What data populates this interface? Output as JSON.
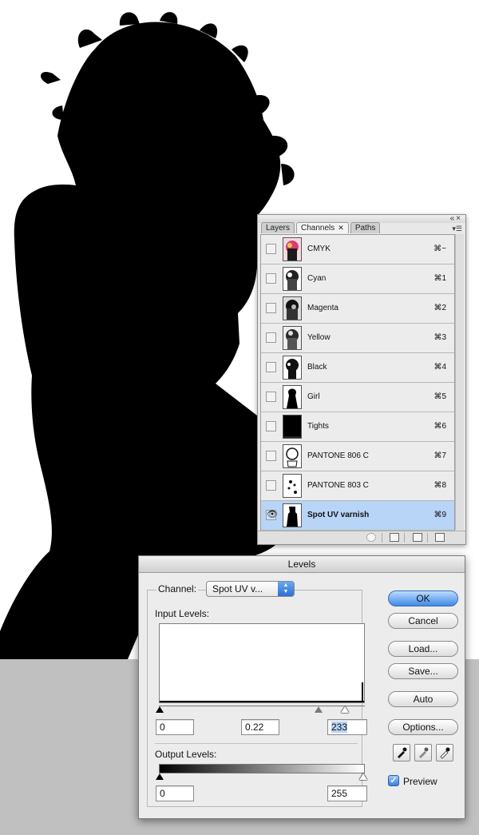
{
  "colors": {
    "canvas_bg": "#ffffff",
    "silhouette": "#000000",
    "pasteboard": "#c0c0c0",
    "selected_row": "#b8d4f6",
    "primary_button": "#3f8ae6"
  },
  "channels_panel": {
    "tabs": [
      {
        "label": "Layers"
      },
      {
        "label": "Channels",
        "close_glyph": "✕"
      },
      {
        "label": "Paths"
      }
    ],
    "active_tab": "Channels",
    "channels": [
      {
        "name": "CMYK",
        "shortcut": "⌘~",
        "visible": false
      },
      {
        "name": "Cyan",
        "shortcut": "⌘1",
        "visible": false
      },
      {
        "name": "Magenta",
        "shortcut": "⌘2",
        "visible": false
      },
      {
        "name": "Yellow",
        "shortcut": "⌘3",
        "visible": false
      },
      {
        "name": "Black",
        "shortcut": "⌘4",
        "visible": false
      },
      {
        "name": "Girl",
        "shortcut": "⌘5",
        "visible": false
      },
      {
        "name": "Tights",
        "shortcut": "⌘6",
        "visible": false
      },
      {
        "name": "PANTONE 806 C",
        "shortcut": "⌘7",
        "visible": false
      },
      {
        "name": "PANTONE 803 C",
        "shortcut": "⌘8",
        "visible": false
      },
      {
        "name": "Spot UV varnish",
        "shortcut": "⌘9",
        "visible": true,
        "selected": true
      }
    ],
    "visible_icon": "eye-icon"
  },
  "levels_dialog": {
    "title": "Levels",
    "channel_label": "Channel:",
    "channel_value": "Spot UV v...",
    "input_levels_label": "Input Levels:",
    "input_black": "0",
    "input_gamma": "0.22",
    "input_white": "233",
    "output_levels_label": "Output Levels:",
    "output_black": "0",
    "output_white": "255",
    "buttons": {
      "ok": "OK",
      "cancel": "Cancel",
      "load": "Load...",
      "save": "Save...",
      "auto": "Auto",
      "options": "Options..."
    },
    "preview_label": "Preview",
    "preview_checked": true
  }
}
